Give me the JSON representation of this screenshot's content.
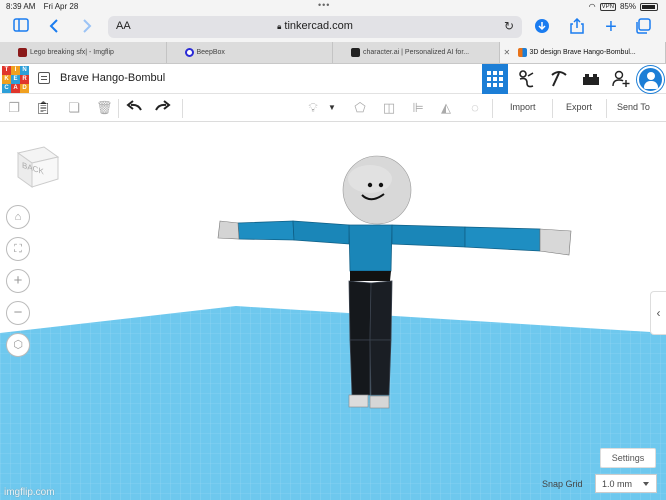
{
  "status_bar": {
    "time": "8:39 AM",
    "date": "Fri Apr 28",
    "battery": "85%",
    "signal": "VPN"
  },
  "browser": {
    "address_aa": "AA",
    "url": "tinkercad.com",
    "tabs": [
      {
        "label": "Lego breaking sfx| - Imgflip",
        "favicon_color": "#8b1a1a"
      },
      {
        "label": "BeepBox",
        "favicon_color": "#2b2bd6"
      },
      {
        "label": "character.ai | Personalized AI for...",
        "favicon_color": "#222222"
      },
      {
        "label": "3D design Brave Hango-Bombul...",
        "favicon_color": "#e8731a",
        "active": true
      }
    ]
  },
  "tinkercad": {
    "logo_letters": [
      "T",
      "I",
      "N",
      "K",
      "E",
      "R",
      "C",
      "A",
      "D"
    ],
    "project_title": "Brave Hango-Bombul"
  },
  "toolbar": {
    "import_label": "Import",
    "export_label": "Export",
    "sendto_label": "Send To"
  },
  "workspace": {
    "viewcube_label": "BACK",
    "settings_label": "Settings",
    "snap_grid_label": "Snap Grid",
    "snap_grid_value": "1.0 mm",
    "watermark": "imgflip.com"
  },
  "colors": {
    "accent": "#1c7ed6",
    "shirt": "#1a86b8",
    "pants": "#15181c",
    "head": "#dcdcdc",
    "grid": "#66c6ec"
  }
}
